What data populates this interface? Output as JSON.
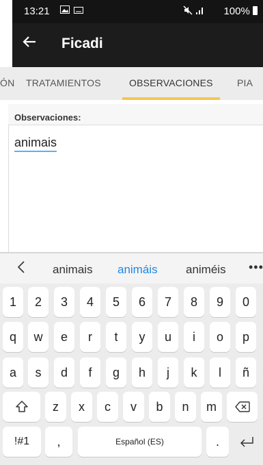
{
  "status_bar": {
    "time": "13:21",
    "battery": "100%"
  },
  "app_bar": {
    "title": "Ficadi"
  },
  "tabs": [
    {
      "label": "ÓN"
    },
    {
      "label": "TRATAMIENTOS"
    },
    {
      "label": "OBSERVACIONES"
    },
    {
      "label": "PIA"
    }
  ],
  "panel": {
    "label": "Observaciones:",
    "value": "animais"
  },
  "suggestions": {
    "items": [
      "animais",
      "animáis",
      "animéis"
    ],
    "highlight_color": "#1e88e5"
  },
  "keyboard": {
    "row1": [
      "1",
      "2",
      "3",
      "4",
      "5",
      "6",
      "7",
      "8",
      "9",
      "0"
    ],
    "row2": [
      "q",
      "w",
      "e",
      "r",
      "t",
      "y",
      "u",
      "i",
      "o",
      "p"
    ],
    "row3": [
      "a",
      "s",
      "d",
      "f",
      "g",
      "h",
      "j",
      "k",
      "l",
      "ñ"
    ],
    "row4": [
      "z",
      "x",
      "c",
      "v",
      "b",
      "n",
      "m"
    ],
    "row5": {
      "symbols": "!#1",
      "comma": ",",
      "space": "Español (ES)",
      "period": "."
    }
  },
  "colors": {
    "accent": "#f5c84c",
    "app_bar": "#1c1c1c",
    "underline": "#5ab1f0"
  }
}
